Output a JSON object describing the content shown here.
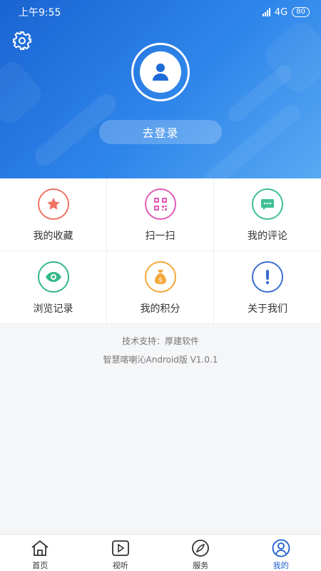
{
  "status_bar": {
    "time": "上午9:55",
    "network": "4G",
    "battery": "80"
  },
  "header": {
    "login_label": "去登录"
  },
  "grid": {
    "items": [
      {
        "label": "我的收藏",
        "icon": "star-icon",
        "color": "#f07466"
      },
      {
        "label": "扫一扫",
        "icon": "qr-code-icon",
        "color": "#e25bb6"
      },
      {
        "label": "我的评论",
        "icon": "comment-icon",
        "color": "#3fbf95"
      },
      {
        "label": "浏览记录",
        "icon": "eye-icon",
        "color": "#34b888"
      },
      {
        "label": "我的积分",
        "icon": "money-bag-icon",
        "color": "#f3a83b"
      },
      {
        "label": "关于我们",
        "icon": "info-icon",
        "color": "#3a6fcf"
      }
    ]
  },
  "footer": {
    "support": "技术支持：厚建软件",
    "version": "智慧喀喇沁Android版 V1.0.1"
  },
  "bottom_nav": {
    "items": [
      {
        "label": "首页",
        "icon": "home-icon"
      },
      {
        "label": "视听",
        "icon": "play-icon"
      },
      {
        "label": "服务",
        "icon": "compass-icon"
      },
      {
        "label": "我的",
        "icon": "user-icon",
        "active": true
      }
    ]
  },
  "colors": {
    "header_start": "#1a64d2",
    "header_end": "#5aa9f3",
    "active_nav": "#1c5fcf"
  }
}
